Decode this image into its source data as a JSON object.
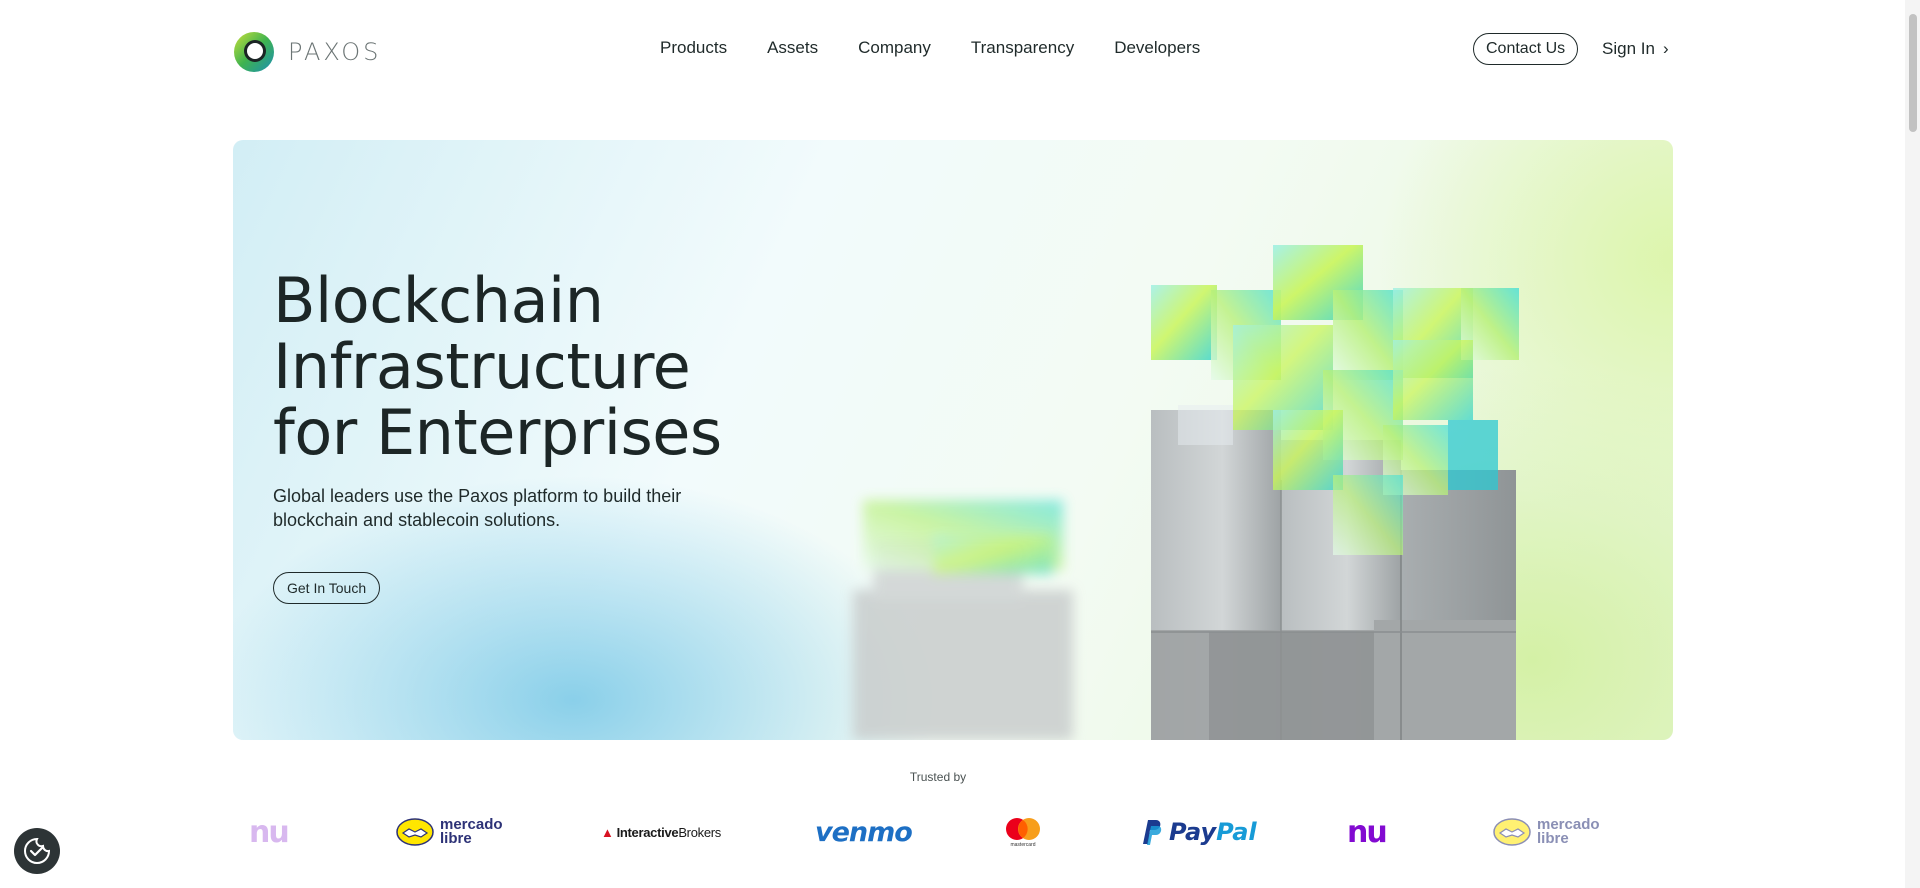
{
  "brand": {
    "name": "PAXOS"
  },
  "nav": {
    "items": [
      {
        "label": "Products"
      },
      {
        "label": "Assets"
      },
      {
        "label": "Company"
      },
      {
        "label": "Transparency"
      },
      {
        "label": "Developers"
      }
    ],
    "contact_label": "Contact Us",
    "signin_label": "Sign In",
    "signin_chevron": "›"
  },
  "hero": {
    "title_line1": "Blockchain",
    "title_line2": "Infrastructure",
    "title_line3": "for Enterprises",
    "subtitle": "Global leaders use the Paxos platform to build their blockchain and stablecoin solutions.",
    "cta_label": "Get In Touch"
  },
  "trusted": {
    "heading": "Trusted by",
    "logos": [
      {
        "name": "nu",
        "text": "nu"
      },
      {
        "name": "mercado-libre",
        "line1": "mercado",
        "line2": "libre"
      },
      {
        "name": "interactive-brokers",
        "bold": "Interactive",
        "light": "Brokers"
      },
      {
        "name": "venmo",
        "text": "venmo"
      },
      {
        "name": "mastercard",
        "text": "mastercard"
      },
      {
        "name": "paypal",
        "pay": "Pay",
        "pal": "Pal"
      },
      {
        "name": "nu",
        "text": "nu"
      },
      {
        "name": "mercado-libre",
        "line1": "mercado",
        "line2": "libre"
      }
    ]
  },
  "colors": {
    "text": "#1f2a2a",
    "nu_purple": "#820ad1",
    "venmo_blue": "#1d6fc4",
    "paypal_navy": "#1b3b8f",
    "paypal_light": "#179bd7",
    "logo_green": "#8cc63f",
    "logo_teal": "#1a9fb4"
  },
  "icons": {
    "logo": "paxos-ring-logo-icon",
    "cookie": "cookie-settings-icon",
    "chevron": "chevron-right-icon"
  }
}
